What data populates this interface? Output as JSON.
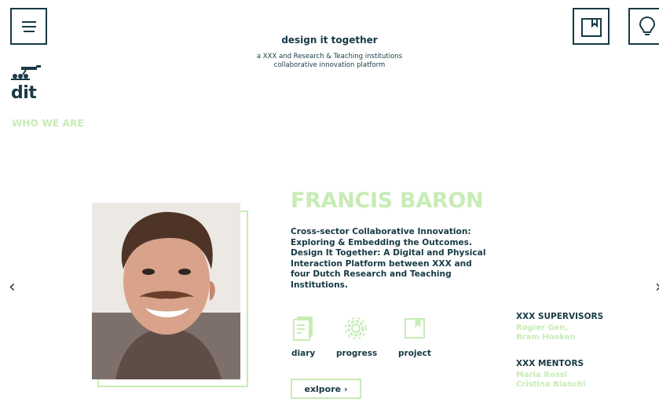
{
  "header": {
    "title": "design it together",
    "subtitle_line1": "a XXX and Research & Teaching institutions",
    "subtitle_line2": "collaborative innovation platform",
    "menu_icon": "hamburger-menu-icon",
    "bookmark_icon": "bookmark-icon",
    "idea_icon": "lightbulb-icon"
  },
  "logo": {
    "text": "dit"
  },
  "nav": {
    "who_we_are": "WHO WE ARE"
  },
  "profile": {
    "name": "FRANCIS BARON",
    "description": "Cross-sector Collaborative Innovation: Exploring & Embedding the Outcomes. Design It Together: A Digital and Physical Interaction Platform between XXX and four Dutch Research and Teaching Institutions.",
    "tiles": [
      {
        "label": "diary",
        "icon": "diary-icon"
      },
      {
        "label": "progress",
        "icon": "gear-icon"
      },
      {
        "label": "project",
        "icon": "project-icon"
      }
    ],
    "explore_label": "exlpore ›"
  },
  "supervisors": {
    "title": "XXX SUPERVISORS",
    "names": [
      "Rogier Gen,",
      "Bram Hooken"
    ]
  },
  "mentors": {
    "title": "XXX MENTORS",
    "names": [
      "Maria Rossi",
      "Cristina Bianchi"
    ]
  },
  "carousel": {
    "prev": "‹",
    "next": "›"
  },
  "colors": {
    "dark": "#173a44",
    "accent": "#c7ecb5"
  }
}
